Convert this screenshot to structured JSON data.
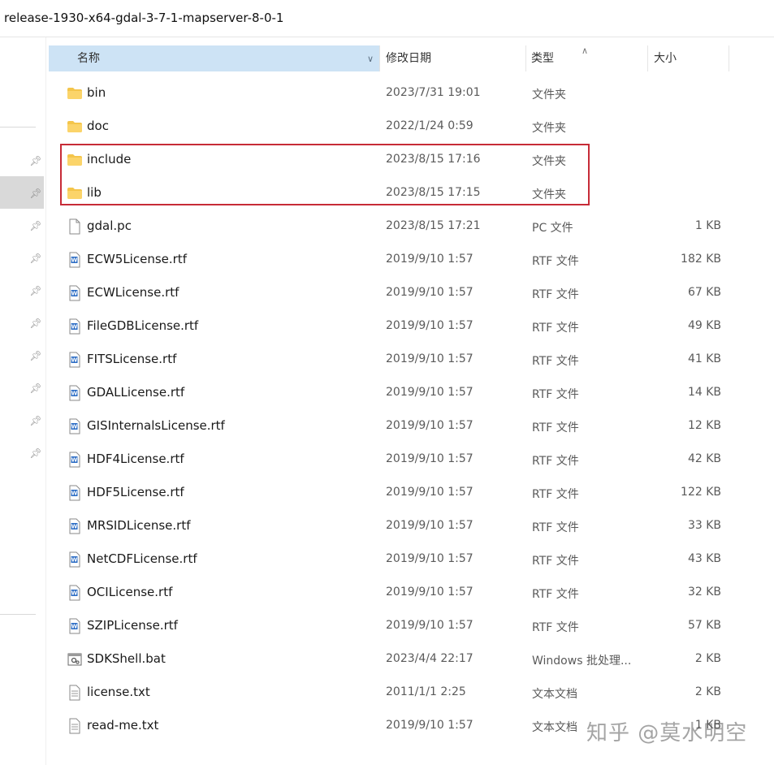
{
  "window": {
    "path": "release-1930-x64-gdal-3-7-1-mapserver-8-0-1"
  },
  "columns": {
    "name": "名称",
    "date": "修改日期",
    "type": "类型",
    "size": "大小"
  },
  "files": [
    {
      "name": "bin",
      "date": "2023/7/31 19:01",
      "type": "文件夹",
      "size": "",
      "icon": "folder-icon"
    },
    {
      "name": "doc",
      "date": "2022/1/24 0:59",
      "type": "文件夹",
      "size": "",
      "icon": "folder-icon"
    },
    {
      "name": "include",
      "date": "2023/8/15 17:16",
      "type": "文件夹",
      "size": "",
      "icon": "folder-icon"
    },
    {
      "name": "lib",
      "date": "2023/8/15 17:15",
      "type": "文件夹",
      "size": "",
      "icon": "folder-icon"
    },
    {
      "name": "gdal.pc",
      "date": "2023/8/15 17:21",
      "type": "PC 文件",
      "size": "1 KB",
      "icon": "generic-file-icon"
    },
    {
      "name": "ECW5License.rtf",
      "date": "2019/9/10 1:57",
      "type": "RTF 文件",
      "size": "182 KB",
      "icon": "word-rtf-icon"
    },
    {
      "name": "ECWLicense.rtf",
      "date": "2019/9/10 1:57",
      "type": "RTF 文件",
      "size": "67 KB",
      "icon": "word-rtf-icon"
    },
    {
      "name": "FileGDBLicense.rtf",
      "date": "2019/9/10 1:57",
      "type": "RTF 文件",
      "size": "49 KB",
      "icon": "word-rtf-icon"
    },
    {
      "name": "FITSLicense.rtf",
      "date": "2019/9/10 1:57",
      "type": "RTF 文件",
      "size": "41 KB",
      "icon": "word-rtf-icon"
    },
    {
      "name": "GDALLicense.rtf",
      "date": "2019/9/10 1:57",
      "type": "RTF 文件",
      "size": "14 KB",
      "icon": "word-rtf-icon"
    },
    {
      "name": "GISInternalsLicense.rtf",
      "date": "2019/9/10 1:57",
      "type": "RTF 文件",
      "size": "12 KB",
      "icon": "word-rtf-icon"
    },
    {
      "name": "HDF4License.rtf",
      "date": "2019/9/10 1:57",
      "type": "RTF 文件",
      "size": "42 KB",
      "icon": "word-rtf-icon"
    },
    {
      "name": "HDF5License.rtf",
      "date": "2019/9/10 1:57",
      "type": "RTF 文件",
      "size": "122 KB",
      "icon": "word-rtf-icon"
    },
    {
      "name": "MRSIDLicense.rtf",
      "date": "2019/9/10 1:57",
      "type": "RTF 文件",
      "size": "33 KB",
      "icon": "word-rtf-icon"
    },
    {
      "name": "NetCDFLicense.rtf",
      "date": "2019/9/10 1:57",
      "type": "RTF 文件",
      "size": "43 KB",
      "icon": "word-rtf-icon"
    },
    {
      "name": "OCILicense.rtf",
      "date": "2019/9/10 1:57",
      "type": "RTF 文件",
      "size": "32 KB",
      "icon": "word-rtf-icon"
    },
    {
      "name": "SZIPLicense.rtf",
      "date": "2019/9/10 1:57",
      "type": "RTF 文件",
      "size": "57 KB",
      "icon": "word-rtf-icon"
    },
    {
      "name": "SDKShell.bat",
      "date": "2023/4/4 22:17",
      "type": "Windows 批处理...",
      "size": "2 KB",
      "icon": "batch-file-icon"
    },
    {
      "name": "license.txt",
      "date": "2011/1/1 2:25",
      "type": "文本文档",
      "size": "2 KB",
      "icon": "text-file-icon"
    },
    {
      "name": "read-me.txt",
      "date": "2019/9/10 1:57",
      "type": "文本文档",
      "size": "1 KB",
      "icon": "text-file-icon"
    }
  ],
  "watermark": "知乎 @莫水明空",
  "colors": {
    "header_selected": "#cde3f5",
    "highlight_border": "#c72b37",
    "folder": "#f4c54b"
  }
}
